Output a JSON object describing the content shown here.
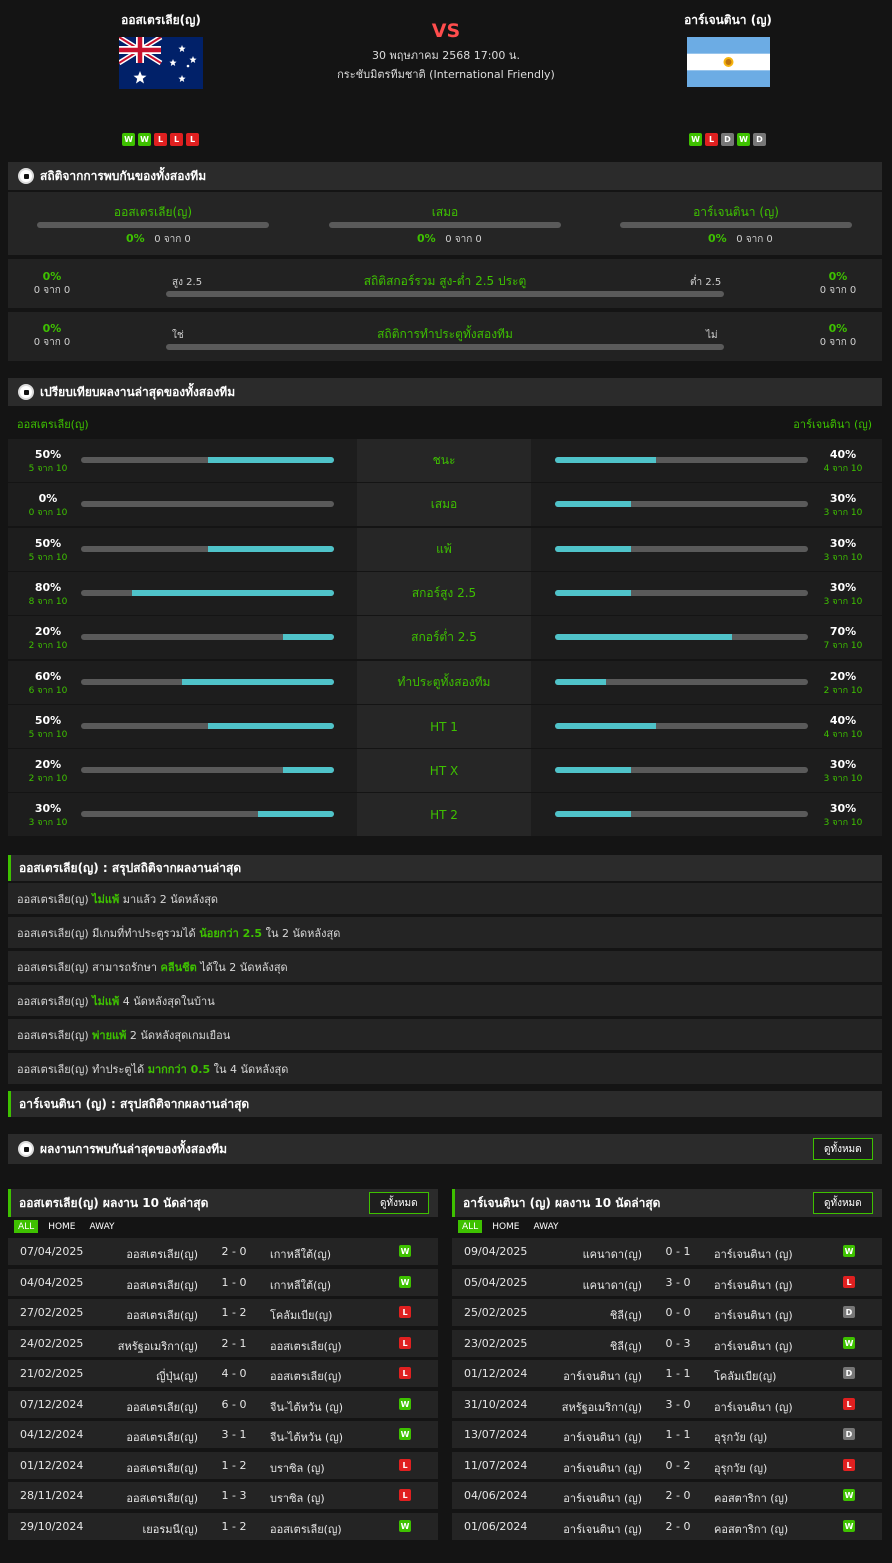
{
  "header": {
    "home_team": "ออสเตรเลีย(ญ)",
    "away_team": "อาร์เจนตินา (ญ)",
    "vs": "VS",
    "datetime": "30 พฤษภาคม 2568 17:00 น.",
    "competition": "กระชับมิตรทีมชาติ (International Friendly)",
    "home_form": [
      "W",
      "W",
      "L",
      "L",
      "L"
    ],
    "away_form": [
      "W",
      "L",
      "D",
      "W",
      "D"
    ]
  },
  "h2h": {
    "title": "สถิติจากการพบกันของทั้งสองทีม",
    "cols": [
      {
        "label": "ออสเตรเลีย(ญ)",
        "pct": "0%",
        "sub": "0 จาก 0"
      },
      {
        "label": "เสมอ",
        "pct": "0%",
        "sub": "0 จาก 0"
      },
      {
        "label": "อาร์เจนตินา (ญ)",
        "pct": "0%",
        "sub": "0 จาก 0"
      }
    ],
    "ou": {
      "title": "สถิติสกอร์รวม สูง-ต่ำ 2.5 ประตู",
      "left_label": "สูง 2.5",
      "right_label": "ต่ำ 2.5",
      "left_pct": "0%",
      "left_sub": "0 จาก 0",
      "right_pct": "0%",
      "right_sub": "0 จาก 0"
    },
    "btts": {
      "title": "สถิติการทำประตูทั้งสองทีม",
      "left_label": "ใช่",
      "right_label": "ไม่",
      "left_pct": "0%",
      "left_sub": "0 จาก 0",
      "right_pct": "0%",
      "right_sub": "0 จาก 0"
    }
  },
  "compare": {
    "title": "เปรียบเทียบผลงานล่าสุดของทั้งสองทีม",
    "home_label": "ออสเตรเลีย(ญ)",
    "away_label": "อาร์เจนตินา (ญ)",
    "rows": [
      {
        "label": "ชนะ",
        "home_pct": "50%",
        "home_sub": "5 จาก 10",
        "home_val": 0.5,
        "away_pct": "40%",
        "away_sub": "4 จาก 10",
        "away_val": 0.4
      },
      {
        "label": "เสมอ",
        "home_pct": "0%",
        "home_sub": "0 จาก 10",
        "home_val": 0.0,
        "away_pct": "30%",
        "away_sub": "3 จาก 10",
        "away_val": 0.3
      },
      {
        "label": "แพ้",
        "home_pct": "50%",
        "home_sub": "5 จาก 10",
        "home_val": 0.5,
        "away_pct": "30%",
        "away_sub": "3 จาก 10",
        "away_val": 0.3
      },
      {
        "label": "สกอร์สูง 2.5",
        "home_pct": "80%",
        "home_sub": "8 จาก 10",
        "home_val": 0.8,
        "away_pct": "30%",
        "away_sub": "3 จาก 10",
        "away_val": 0.3
      },
      {
        "label": "สกอร์ต่ำ 2.5",
        "home_pct": "20%",
        "home_sub": "2 จาก 10",
        "home_val": 0.2,
        "away_pct": "70%",
        "away_sub": "7 จาก 10",
        "away_val": 0.7
      },
      {
        "label": "ทำประตูทั้งสองทีม",
        "home_pct": "60%",
        "home_sub": "6 จาก 10",
        "home_val": 0.6,
        "away_pct": "20%",
        "away_sub": "2 จาก 10",
        "away_val": 0.2
      },
      {
        "label": "HT 1",
        "home_pct": "50%",
        "home_sub": "5 จาก 10",
        "home_val": 0.5,
        "away_pct": "40%",
        "away_sub": "4 จาก 10",
        "away_val": 0.4
      },
      {
        "label": "HT X",
        "home_pct": "20%",
        "home_sub": "2 จาก 10",
        "home_val": 0.2,
        "away_pct": "30%",
        "away_sub": "3 จาก 10",
        "away_val": 0.3
      },
      {
        "label": "HT 2",
        "home_pct": "30%",
        "home_sub": "3 จาก 10",
        "home_val": 0.3,
        "away_pct": "30%",
        "away_sub": "3 จาก 10",
        "away_val": 0.3
      }
    ]
  },
  "summary_home": {
    "title": "ออสเตรเลีย(ญ) : สรุปสถิติจากผลงานล่าสุด",
    "rows": [
      {
        "pre": "ออสเตรเลีย(ญ) ",
        "hl": "ไม่แพ้",
        "post": " มาแล้ว 2 นัดหลังสุด"
      },
      {
        "pre": "ออสเตรเลีย(ญ) มีเกมที่ทำประตูรวมได้ ",
        "hl": "น้อยกว่า 2.5",
        "post": " ใน 2 นัดหลังสุด"
      },
      {
        "pre": "ออสเตรเลีย(ญ) สามารถรักษา ",
        "hl": "คลีนชีต",
        "post": " ได้ใน 2 นัดหลังสุด"
      },
      {
        "pre": "ออสเตรเลีย(ญ) ",
        "hl": "ไม่แพ้",
        "post": " 4 นัดหลังสุดในบ้าน"
      },
      {
        "pre": "ออสเตรเลีย(ญ) ",
        "hl": "พ่ายแพ้",
        "post": " 2 นัดหลังสุดเกมเยือน"
      },
      {
        "pre": "ออสเตรเลีย(ญ) ทำประตูได้ ",
        "hl": "มากกว่า 0.5",
        "post": " ใน 4 นัดหลังสุด"
      }
    ]
  },
  "summary_away": {
    "title": "อาร์เจนตินา (ญ) : สรุปสถิติจากผลงานล่าสุด"
  },
  "recent_h2h": {
    "title": "ผลงานการพบกันล่าสุดของทั้งสองทีม",
    "view_all": "ดูทั้งหมด"
  },
  "last10_home": {
    "title": "ออสเตรเลีย(ญ) ผลงาน 10 นัดล่าสุด",
    "view_all": "ดูทั้งหมด",
    "tabs": [
      "ALL",
      "HOME",
      "AWAY"
    ],
    "matches": [
      {
        "date": "07/04/2025",
        "home": "ออสเตรเลีย(ญ)",
        "score": "2 - 0",
        "away": "เกาหลีใต้(ญ)",
        "res": "W"
      },
      {
        "date": "04/04/2025",
        "home": "ออสเตรเลีย(ญ)",
        "score": "1 - 0",
        "away": "เกาหลีใต้(ญ)",
        "res": "W"
      },
      {
        "date": "27/02/2025",
        "home": "ออสเตรเลีย(ญ)",
        "score": "1 - 2",
        "away": "โคลัมเบีย(ญ)",
        "res": "L"
      },
      {
        "date": "24/02/2025",
        "home": "สหรัฐอเมริกา(ญ)",
        "score": "2 - 1",
        "away": "ออสเตรเลีย(ญ)",
        "res": "L"
      },
      {
        "date": "21/02/2025",
        "home": "ญี่ปุ่น(ญ)",
        "score": "4 - 0",
        "away": "ออสเตรเลีย(ญ)",
        "res": "L"
      },
      {
        "date": "07/12/2024",
        "home": "ออสเตรเลีย(ญ)",
        "score": "6 - 0",
        "away": "จีน-ไต้หวัน (ญ)",
        "res": "W"
      },
      {
        "date": "04/12/2024",
        "home": "ออสเตรเลีย(ญ)",
        "score": "3 - 1",
        "away": "จีน-ไต้หวัน (ญ)",
        "res": "W"
      },
      {
        "date": "01/12/2024",
        "home": "ออสเตรเลีย(ญ)",
        "score": "1 - 2",
        "away": "บราซิล (ญ)",
        "res": "L"
      },
      {
        "date": "28/11/2024",
        "home": "ออสเตรเลีย(ญ)",
        "score": "1 - 3",
        "away": "บราซิล (ญ)",
        "res": "L"
      },
      {
        "date": "29/10/2024",
        "home": "เยอรมนี(ญ)",
        "score": "1 - 2",
        "away": "ออสเตรเลีย(ญ)",
        "res": "W"
      }
    ]
  },
  "last10_away": {
    "title": "อาร์เจนตินา (ญ) ผลงาน 10 นัดล่าสุด",
    "view_all": "ดูทั้งหมด",
    "tabs": [
      "ALL",
      "HOME",
      "AWAY"
    ],
    "matches": [
      {
        "date": "09/04/2025",
        "home": "แคนาดา(ญ)",
        "score": "0 - 1",
        "away": "อาร์เจนตินา (ญ)",
        "res": "W"
      },
      {
        "date": "05/04/2025",
        "home": "แคนาดา(ญ)",
        "score": "3 - 0",
        "away": "อาร์เจนตินา (ญ)",
        "res": "L"
      },
      {
        "date": "25/02/2025",
        "home": "ชิลี(ญ)",
        "score": "0 - 0",
        "away": "อาร์เจนตินา (ญ)",
        "res": "D"
      },
      {
        "date": "23/02/2025",
        "home": "ชิลี(ญ)",
        "score": "0 - 3",
        "away": "อาร์เจนตินา (ญ)",
        "res": "W"
      },
      {
        "date": "01/12/2024",
        "home": "อาร์เจนตินา (ญ)",
        "score": "1 - 1",
        "away": "โคลัมเบีย(ญ)",
        "res": "D"
      },
      {
        "date": "31/10/2024",
        "home": "สหรัฐอเมริกา(ญ)",
        "score": "3 - 0",
        "away": "อาร์เจนตินา (ญ)",
        "res": "L"
      },
      {
        "date": "13/07/2024",
        "home": "อาร์เจนตินา (ญ)",
        "score": "1 - 1",
        "away": "อุรุกวัย (ญ)",
        "res": "D"
      },
      {
        "date": "11/07/2024",
        "home": "อาร์เจนตินา (ญ)",
        "score": "0 - 2",
        "away": "อุรุกวัย (ญ)",
        "res": "L"
      },
      {
        "date": "04/06/2024",
        "home": "อาร์เจนตินา (ญ)",
        "score": "2 - 0",
        "away": "คอสตาริกา (ญ)",
        "res": "W"
      },
      {
        "date": "01/06/2024",
        "home": "อาร์เจนตินา (ญ)",
        "score": "2 - 0",
        "away": "คอสตาริกา (ญ)",
        "res": "W"
      }
    ]
  },
  "colors": {
    "accent": "#3ec100",
    "bar_fill": "#4fc3c9",
    "win": "#3ec100",
    "loss": "#e02020",
    "draw": "#777777"
  }
}
